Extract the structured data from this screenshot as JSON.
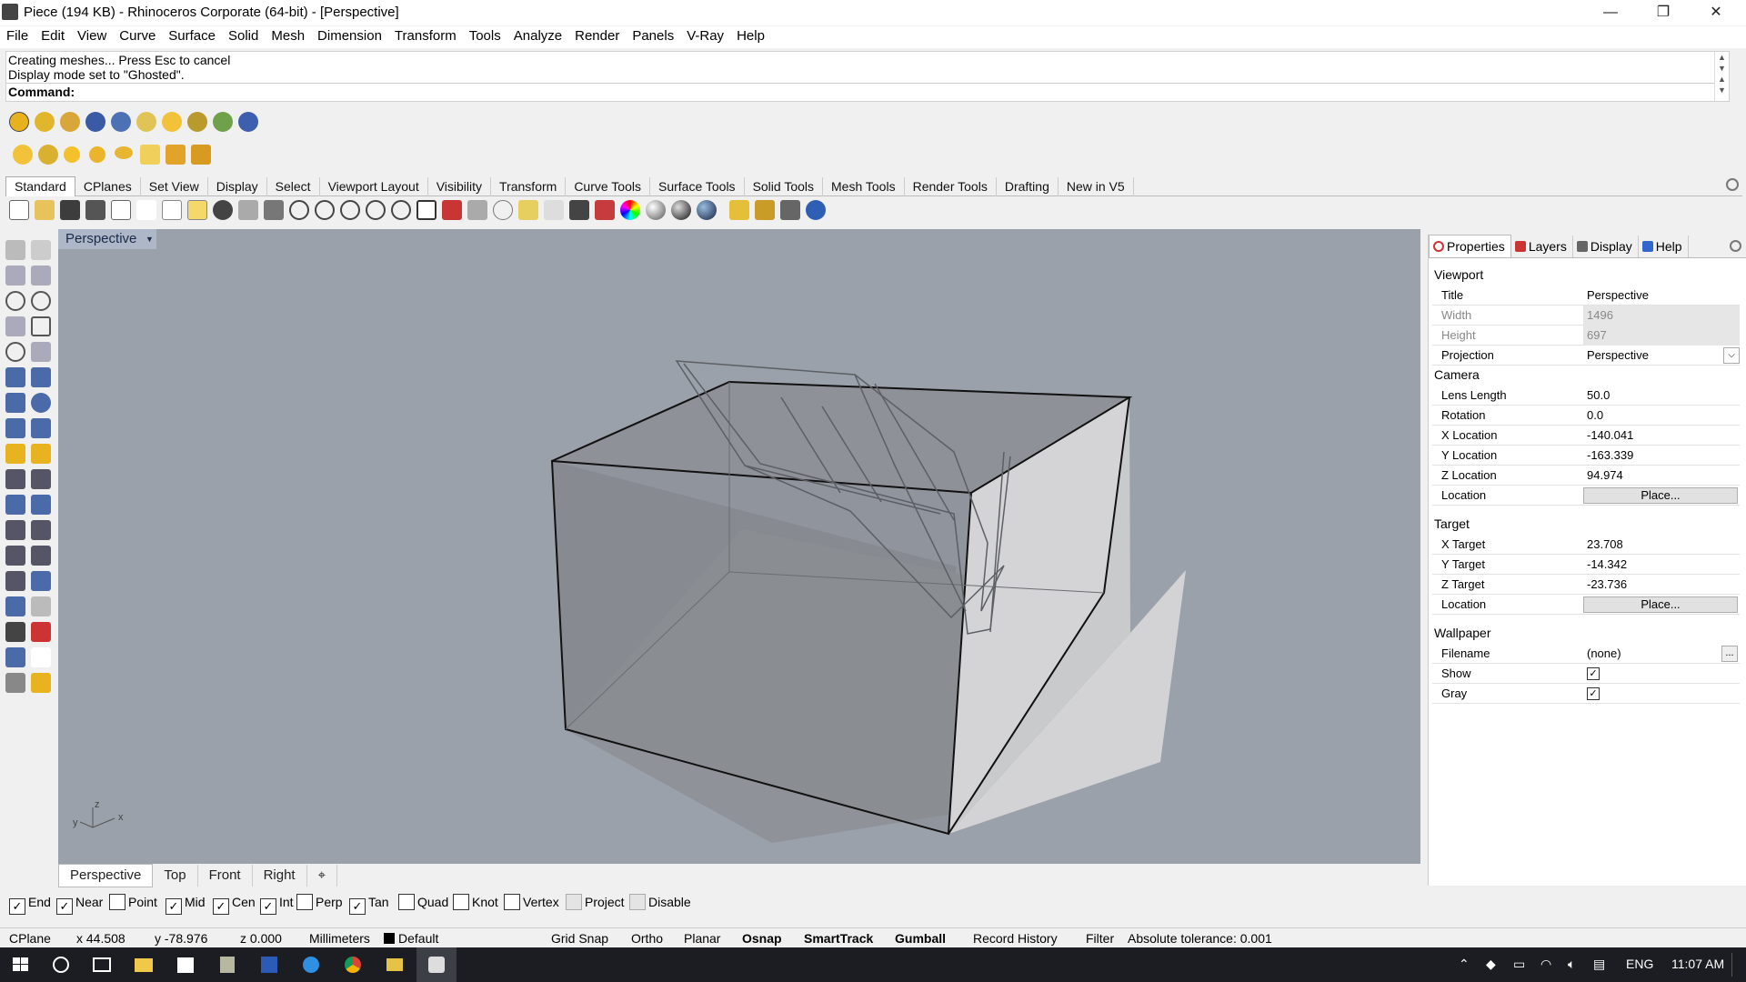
{
  "window": {
    "title": "Piece (194 KB) - Rhinoceros Corporate (64-bit) - [Perspective]",
    "minimize": "—",
    "maximize": "❐",
    "close": "✕"
  },
  "menu": [
    "File",
    "Edit",
    "View",
    "Curve",
    "Surface",
    "Solid",
    "Mesh",
    "Dimension",
    "Transform",
    "Tools",
    "Analyze",
    "Render",
    "Panels",
    "V-Ray",
    "Help"
  ],
  "command": {
    "history": [
      "Creating meshes... Press Esc to cancel",
      "Display mode set to \"Ghosted\"."
    ],
    "prompt": "Command:"
  },
  "toolbar_tabs": [
    "Standard",
    "CPlanes",
    "Set View",
    "Display",
    "Select",
    "Viewport Layout",
    "Visibility",
    "Transform",
    "Curve Tools",
    "Surface Tools",
    "Solid Tools",
    "Mesh Tools",
    "Render Tools",
    "Drafting",
    "New in V5"
  ],
  "viewport": {
    "label": "Perspective",
    "axes": {
      "z": "z",
      "x": "x",
      "y": "y"
    }
  },
  "viewport_tabs": [
    "Perspective",
    "Top",
    "Front",
    "Right"
  ],
  "viewport_tab_add": "⌖",
  "osnaps": [
    {
      "label": "End",
      "checked": true
    },
    {
      "label": "Near",
      "checked": true
    },
    {
      "label": "Point",
      "checked": false
    },
    {
      "label": "Mid",
      "checked": true
    },
    {
      "label": "Cen",
      "checked": true
    },
    {
      "label": "Int",
      "checked": true
    },
    {
      "label": "Perp",
      "checked": false
    },
    {
      "label": "Tan",
      "checked": true
    },
    {
      "label": "Quad",
      "checked": false
    },
    {
      "label": "Knot",
      "checked": false
    },
    {
      "label": "Vertex",
      "checked": false
    },
    {
      "label": "Project",
      "checked": false
    },
    {
      "label": "Disable",
      "checked": false
    }
  ],
  "status": {
    "cplane": "CPlane",
    "x": "x 44.508",
    "y": "y -78.976",
    "z": "z 0.000",
    "units": "Millimeters",
    "layer": "Default",
    "grid_snap": "Grid Snap",
    "ortho": "Ortho",
    "planar": "Planar",
    "osnap": "Osnap",
    "smarttrack": "SmartTrack",
    "gumball": "Gumball",
    "record_history": "Record History",
    "filter": "Filter",
    "tolerance": "Absolute tolerance: 0.001"
  },
  "panel": {
    "tabs": [
      "Properties",
      "Layers",
      "Display",
      "Help"
    ],
    "sections": {
      "viewport": "Viewport",
      "camera": "Camera",
      "target": "Target",
      "wallpaper": "Wallpaper"
    },
    "viewport_rows": {
      "title_k": "Title",
      "title_v": "Perspective",
      "width_k": "Width",
      "width_v": "1496",
      "height_k": "Height",
      "height_v": "697",
      "projection_k": "Projection",
      "projection_v": "Perspective"
    },
    "camera_rows": {
      "lens_k": "Lens Length",
      "lens_v": "50.0",
      "rotation_k": "Rotation",
      "rotation_v": "0.0",
      "xloc_k": "X Location",
      "xloc_v": "-140.041",
      "yloc_k": "Y Location",
      "yloc_v": "-163.339",
      "zloc_k": "Z Location",
      "zloc_v": "94.974",
      "loc_k": "Location",
      "loc_btn": "Place..."
    },
    "target_rows": {
      "xt_k": "X Target",
      "xt_v": "23.708",
      "yt_k": "Y Target",
      "yt_v": "-14.342",
      "zt_k": "Z Target",
      "zt_v": "-23.736",
      "loc_k": "Location",
      "loc_btn": "Place..."
    },
    "wallpaper_rows": {
      "file_k": "Filename",
      "file_v": "(none)",
      "file_btn": "...",
      "show_k": "Show",
      "show_checked": true,
      "gray_k": "Gray",
      "gray_checked": true
    }
  },
  "taskbar": {
    "lang": "ENG",
    "time": "11:07 AM"
  }
}
